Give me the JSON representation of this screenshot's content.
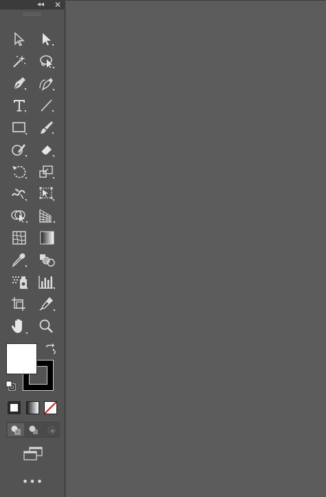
{
  "panel": {
    "collapse_glyph": "◂◂",
    "close_glyph": "✕",
    "more_glyph": "•••"
  },
  "tools": [
    {
      "name": "selection-tool-icon"
    },
    {
      "name": "direct-selection-tool-icon"
    },
    {
      "name": "magic-wand-tool-icon"
    },
    {
      "name": "lasso-tool-icon"
    },
    {
      "name": "pen-tool-icon"
    },
    {
      "name": "curvature-tool-icon"
    },
    {
      "name": "type-tool-icon"
    },
    {
      "name": "line-segment-tool-icon"
    },
    {
      "name": "rectangle-tool-icon"
    },
    {
      "name": "paintbrush-tool-icon"
    },
    {
      "name": "shaper-tool-icon"
    },
    {
      "name": "eraser-tool-icon"
    },
    {
      "name": "rotate-tool-icon"
    },
    {
      "name": "scale-tool-icon"
    },
    {
      "name": "width-tool-icon"
    },
    {
      "name": "free-transform-tool-icon"
    },
    {
      "name": "shape-builder-tool-icon"
    },
    {
      "name": "perspective-grid-tool-icon"
    },
    {
      "name": "mesh-tool-icon"
    },
    {
      "name": "gradient-tool-icon"
    },
    {
      "name": "eyedropper-tool-icon"
    },
    {
      "name": "blend-tool-icon"
    },
    {
      "name": "symbol-sprayer-tool-icon"
    },
    {
      "name": "column-graph-tool-icon"
    },
    {
      "name": "artboard-tool-icon"
    },
    {
      "name": "slice-tool-icon"
    },
    {
      "name": "hand-tool-icon"
    },
    {
      "name": "zoom-tool-icon"
    }
  ],
  "colors": {
    "fill": "#ffffff",
    "stroke": "#000000",
    "none_slash": "#e0201f"
  }
}
